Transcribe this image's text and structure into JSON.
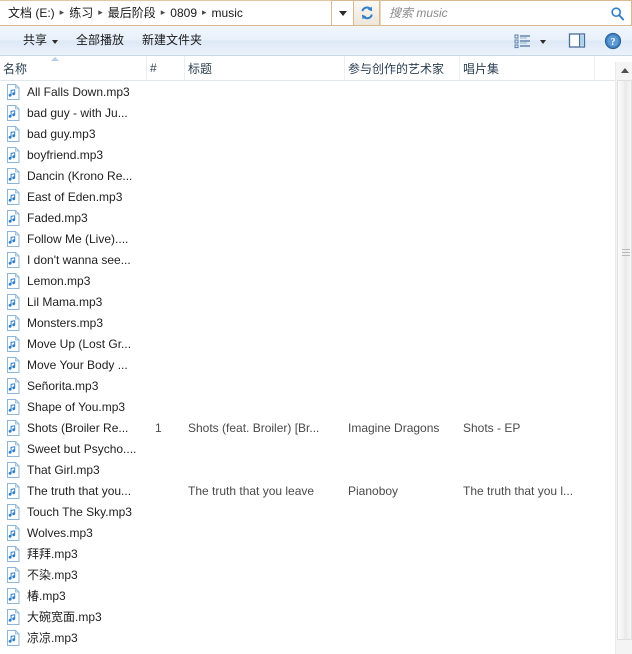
{
  "address_bar": {
    "breadcrumbs": [
      "文档 (E:)",
      "练习",
      "最后阶段",
      "0809",
      "music"
    ],
    "separator": "▸",
    "dropdown_icon": "chevron-down-icon",
    "refresh_icon": "refresh-icon",
    "search": {
      "placeholder": "搜索 music",
      "value": "",
      "icon": "search-icon"
    }
  },
  "toolbar": {
    "share_label": "共享",
    "play_all_label": "全部播放",
    "new_folder_label": "新建文件夹",
    "view_icon": "view-options-icon",
    "view_caret_icon": "chevron-down-icon",
    "preview_pane_icon": "preview-pane-icon",
    "help_icon": "help-icon"
  },
  "columns": {
    "name": "名称",
    "number": "#",
    "title": "标题",
    "artist": "参与创作的艺术家",
    "album": "唱片集",
    "sorted_by": "名称",
    "sort_direction": "ascending"
  },
  "files": [
    {
      "name": "All Falls Down.mp3",
      "num": "",
      "title": "",
      "artist": "",
      "album": ""
    },
    {
      "name": "bad guy - with Ju...",
      "num": "",
      "title": "",
      "artist": "",
      "album": ""
    },
    {
      "name": "bad guy.mp3",
      "num": "",
      "title": "",
      "artist": "",
      "album": ""
    },
    {
      "name": "boyfriend.mp3",
      "num": "",
      "title": "",
      "artist": "",
      "album": ""
    },
    {
      "name": "Dancin (Krono Re...",
      "num": "",
      "title": "",
      "artist": "",
      "album": ""
    },
    {
      "name": "East of Eden.mp3",
      "num": "",
      "title": "",
      "artist": "",
      "album": ""
    },
    {
      "name": "Faded.mp3",
      "num": "",
      "title": "",
      "artist": "",
      "album": ""
    },
    {
      "name": "Follow Me (Live)....",
      "num": "",
      "title": "",
      "artist": "",
      "album": ""
    },
    {
      "name": "I don't wanna see...",
      "num": "",
      "title": "",
      "artist": "",
      "album": ""
    },
    {
      "name": "Lemon.mp3",
      "num": "",
      "title": "",
      "artist": "",
      "album": ""
    },
    {
      "name": "Lil Mama.mp3",
      "num": "",
      "title": "",
      "artist": "",
      "album": ""
    },
    {
      "name": "Monsters.mp3",
      "num": "",
      "title": "",
      "artist": "",
      "album": ""
    },
    {
      "name": "Move Up (Lost Gr...",
      "num": "",
      "title": "",
      "artist": "",
      "album": ""
    },
    {
      "name": "Move Your Body ...",
      "num": "",
      "title": "",
      "artist": "",
      "album": ""
    },
    {
      "name": "Señorita.mp3",
      "num": "",
      "title": "",
      "artist": "",
      "album": ""
    },
    {
      "name": "Shape of You.mp3",
      "num": "",
      "title": "",
      "artist": "",
      "album": ""
    },
    {
      "name": "Shots (Broiler Re...",
      "num": "1",
      "title": "Shots (feat. Broiler) [Br...",
      "artist": "Imagine Dragons",
      "album": "Shots - EP"
    },
    {
      "name": "Sweet but Psycho....",
      "num": "",
      "title": "",
      "artist": "",
      "album": ""
    },
    {
      "name": "That Girl.mp3",
      "num": "",
      "title": "",
      "artist": "",
      "album": ""
    },
    {
      "name": "The truth that you...",
      "num": "",
      "title": "The truth that you leave",
      "artist": "Pianoboy",
      "album": "The truth that you l..."
    },
    {
      "name": "Touch The Sky.mp3",
      "num": "",
      "title": "",
      "artist": "",
      "album": ""
    },
    {
      "name": "Wolves.mp3",
      "num": "",
      "title": "",
      "artist": "",
      "album": ""
    },
    {
      "name": "拜拜.mp3",
      "num": "",
      "title": "",
      "artist": "",
      "album": ""
    },
    {
      "name": "不染.mp3",
      "num": "",
      "title": "",
      "artist": "",
      "album": ""
    },
    {
      "name": "椿.mp3",
      "num": "",
      "title": "",
      "artist": "",
      "album": ""
    },
    {
      "name": "大碗宽面.mp3",
      "num": "",
      "title": "",
      "artist": "",
      "album": ""
    },
    {
      "name": "凉凉.mp3",
      "num": "",
      "title": "",
      "artist": "",
      "album": ""
    }
  ],
  "scrollbar": {
    "up_arrow_icon": "scroll-up-arrow-icon",
    "thumb": "vertical-scroll-thumb"
  },
  "colors": {
    "address_border": "#d9b894",
    "toolbar_blue": "#e8f0fa",
    "header_text": "#2b3f52",
    "icon_blue": "#3d7cbb"
  }
}
